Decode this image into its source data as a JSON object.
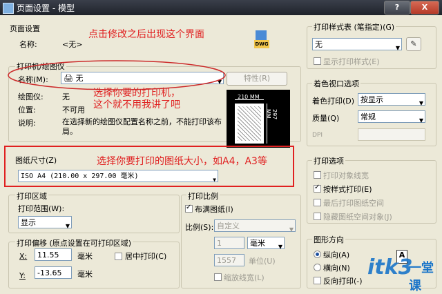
{
  "window": {
    "title": "页面设置 - 模型",
    "help": "?",
    "close": "X"
  },
  "page_setup": {
    "title": "页面设置",
    "name_label": "名称:",
    "name_value": "<无>",
    "dwg_icon_text": "DWG"
  },
  "annotations": {
    "top": "点击修改之后出现这个界面",
    "printer_1": "选择你要的打印机，",
    "printer_2": "这个就不用我讲了吧",
    "paper": "选择你要打印的图纸大小，如A4，A3等"
  },
  "printer": {
    "title": "打印机/绘图仪",
    "name_label": "名称(M):",
    "name_value": "无",
    "props_button": "特性(R)",
    "plotter_label": "绘图仪:",
    "plotter_value": "无",
    "location_label": "位置:",
    "location_value": "不可用",
    "desc_label": "说明:",
    "desc_value": "在选择新的绘图仪配置名称之前，不能打印该布局。",
    "preview_width": "210 MM",
    "preview_height": "297 MM"
  },
  "paper": {
    "title": "图纸尺寸(Z)",
    "value": "ISO A4 (210.00 x 297.00 毫米)"
  },
  "print_area": {
    "title": "打印区域",
    "range_label": "打印范围(W):",
    "range_value": "显示"
  },
  "offset": {
    "title": "打印偏移 (原点设置在可打印区域)",
    "x_label": "X:",
    "x_value": "11.55",
    "x_unit": "毫米",
    "y_label": "Y:",
    "y_value": "-13.65",
    "y_unit": "毫米",
    "center_label": "居中打印(C)"
  },
  "scale": {
    "title": "打印比例",
    "fit_label": "布满图纸(I)",
    "ratio_label": "比例(S):",
    "ratio_value": "自定义",
    "num_value": "1",
    "unit_value": "毫米",
    "den_value": "1557",
    "den_unit": "单位(U)",
    "lineweight_label": "缩放线宽(L)"
  },
  "style_table": {
    "title": "打印样式表 (笔指定)(G)",
    "value": "无",
    "show_label": "显示打印样式(E)"
  },
  "shaded": {
    "title": "着色视口选项",
    "shade_label": "着色打印(D)",
    "shade_value": "按显示",
    "quality_label": "质量(Q)",
    "quality_value": "常规",
    "dpi_label": "DPI"
  },
  "options": {
    "title": "打印选项",
    "items": [
      "打印对象线宽",
      "按样式打印(E)",
      "最后打印图纸空间",
      "隐藏图纸空间对象(J)"
    ]
  },
  "orientation": {
    "title": "图形方向",
    "portrait": "纵向(A)",
    "landscape": "横向(N)",
    "upside": "反向打印(-)"
  },
  "watermark": {
    "text": "itk3",
    "sub": "一堂课"
  }
}
